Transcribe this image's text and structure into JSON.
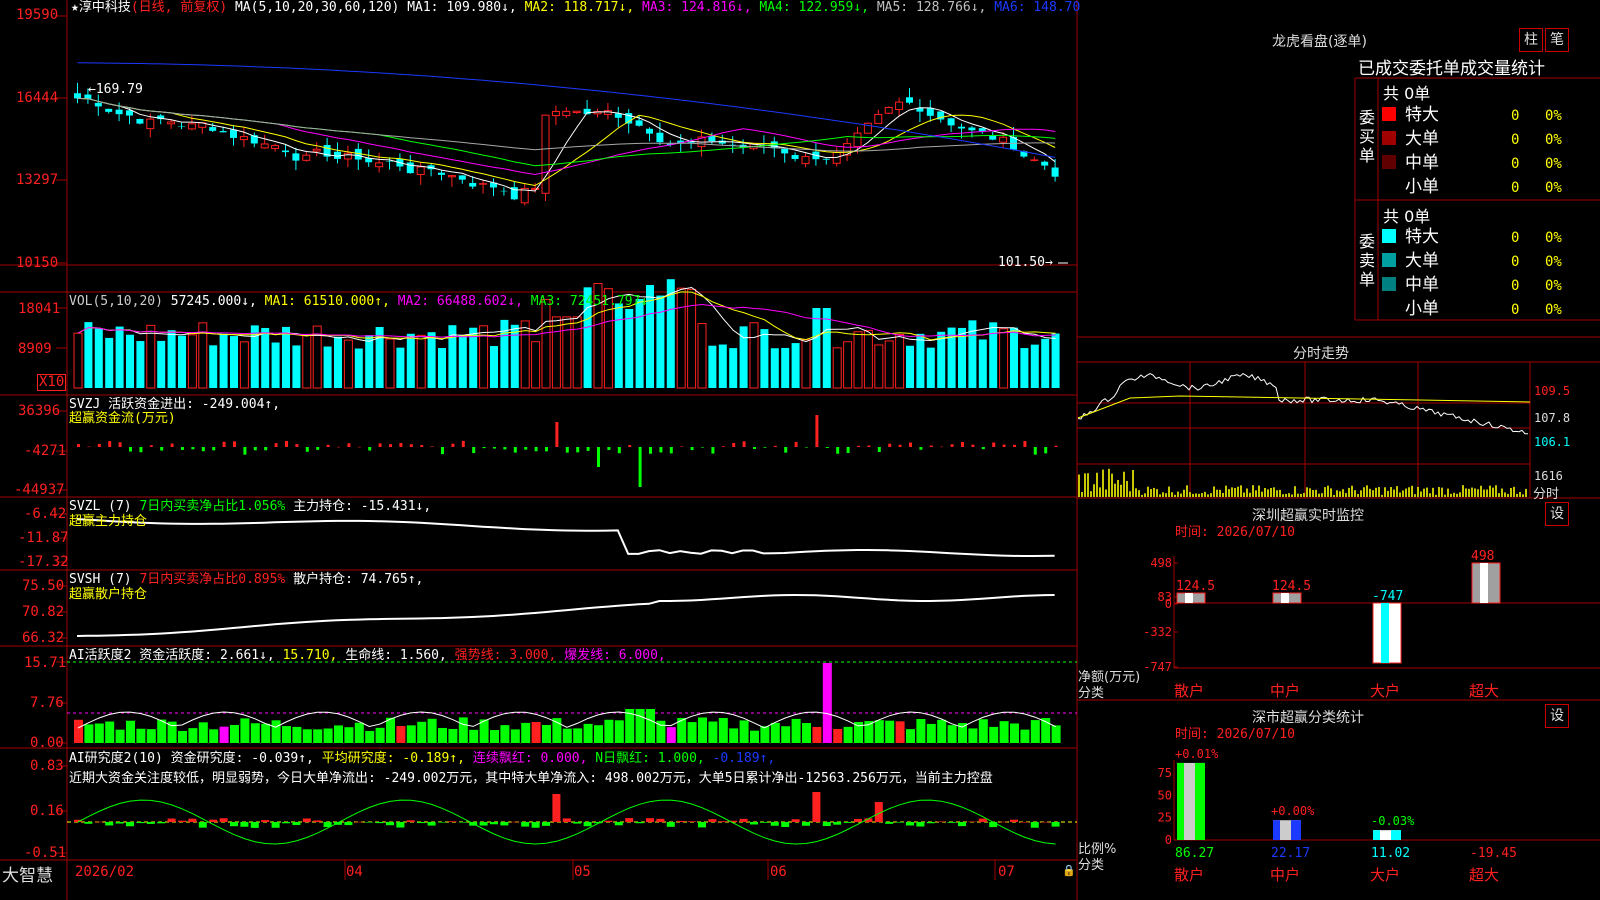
{
  "colors": {
    "up": "#ff2020",
    "down": "#00ffff",
    "grid": "#a00000",
    "yellow": "#ffff00",
    "white": "#ffffff",
    "magenta": "#ff00ff",
    "green": "#00ff00",
    "blue": "#1c39ff",
    "gray": "#a8a8a8",
    "olive": "#c8c800"
  },
  "brand": "大智慧",
  "price_panel": {
    "star": "★",
    "stock_name": "淳中科技",
    "period": "(日线, 前复权)",
    "ma_header": "MA(5,10,20,30,60,120)",
    "ma1": "MA1: 109.980↓,",
    "ma2": "MA2: 118.717↓,",
    "ma3": "MA3: 124.816↓,",
    "ma4": "MA4: 122.959↓,",
    "ma5": "MA5: 128.766↓,",
    "ma6": "MA6: 148.70",
    "high_label": "←169.79",
    "low_label": "101.50→",
    "axis": [
      "19590",
      "16444",
      "13297",
      "10150"
    ]
  },
  "vol_panel": {
    "header": "VOL(5,10,20)",
    "v": "57245.000↓,",
    "ma1": "MA1: 61510.000↑,",
    "ma2": "MA2: 66488.602↓,",
    "ma3": "MA3: 72451.797↓",
    "axis": [
      "18041",
      "8909"
    ],
    "unit": "X10"
  },
  "svzj_panel": {
    "header": "SVZJ  活跃资金进出: -249.004↑,",
    "subtitle": "超赢资金流(万元)",
    "axis": [
      "36396",
      "-4271",
      "-44937"
    ]
  },
  "svzl_panel": {
    "header": "SVZL (7)",
    "ratio": "7日内买卖净占比1.056%",
    "pos": "主力持仓: -15.431↓,",
    "subtitle": "超赢主力持仓",
    "axis": [
      "-6.42",
      "-11.87",
      "-17.32"
    ]
  },
  "svsh_panel": {
    "header": "SVSH (7)",
    "ratio": "7日内买卖净占比0.895%",
    "pos": "散户持仓: 74.765↑,",
    "subtitle": "超赢散户持仓",
    "axis": [
      "75.50",
      "70.82",
      "66.32"
    ]
  },
  "ai_active_panel": {
    "header": "AI活跃度2 资金活跃度: 2.661↓,",
    "v2": "15.710,",
    "life": "生命线: 1.560,",
    "strong": "强势线: 3.000,",
    "burst": "爆发线: 6.000,",
    "axis": [
      "15.71",
      "7.76",
      "0.00"
    ]
  },
  "ai_research_panel": {
    "header": "AI研究度2(10) 资金研究度: -0.039↑,",
    "avg": "平均研究度: -0.189↑,",
    "cont": "连续飘红: 0.000,",
    "nday": "N日飘红: 1.000,",
    "last": "-0.189↑,",
    "comment": "近期大资金关注度较低，明显弱势，今日大单净流出: -249.002万元，其中特大单净流入: 498.002万元，大单5日累计净出-12563.256万元，当前主力控盘",
    "axis": [
      "0.83",
      "0.16",
      "-0.51"
    ]
  },
  "date_axis": [
    "2026/02",
    "04",
    "05",
    "06",
    "07"
  ],
  "right": {
    "lhb_title": "龙虎看盘(逐单)",
    "btn_zhu": "柱",
    "btn_bi": "笔",
    "table_title": "已成交委托单成交量统计",
    "buy": {
      "side": [
        "委",
        "买",
        "单"
      ],
      "total": "共 0单",
      "rows": [
        {
          "label": "特大",
          "v": "0",
          "p": "0%",
          "color": "#ff0000"
        },
        {
          "label": "大单",
          "v": "0",
          "p": "0%",
          "color": "#a00000"
        },
        {
          "label": "中单",
          "v": "0",
          "p": "0%",
          "color": "#600000"
        },
        {
          "label": "小单",
          "v": "0",
          "p": "0%",
          "color": "#000000"
        }
      ]
    },
    "sell": {
      "side": [
        "委",
        "卖",
        "单"
      ],
      "total": "共 0单",
      "rows": [
        {
          "label": "特大",
          "v": "0",
          "p": "0%",
          "color": "#00ffff"
        },
        {
          "label": "大单",
          "v": "0",
          "p": "0%",
          "color": "#00a0a0"
        },
        {
          "label": "中单",
          "v": "0",
          "p": "0%",
          "color": "#008080"
        },
        {
          "label": "小单",
          "v": "0",
          "p": "0%",
          "color": "#000000"
        }
      ]
    },
    "intraday_title": "分时走势",
    "intraday_axis": [
      "109.5",
      "107.8",
      "106.1"
    ],
    "intraday_vol": [
      "1616",
      "分时"
    ],
    "sz_monitor": {
      "title": "深圳超赢实时监控",
      "btn": "设",
      "time": "时间: 2026/07/10",
      "ylabels": [
        "498",
        "83",
        "0",
        "-332",
        "-747"
      ],
      "unit1": "净额(万元)",
      "unit2": "分类",
      "categories": [
        "散户",
        "中户",
        "大户",
        "超大"
      ],
      "values": [
        124.5,
        124.5,
        -747,
        498
      ],
      "value_labels": [
        "124.5",
        "124.5",
        "-747",
        "498"
      ]
    },
    "sz_class": {
      "title": "深市超赢分类统计",
      "btn": "设",
      "time": "时间: 2026/07/10",
      "ylabels": [
        "75",
        "50",
        "25",
        "0"
      ],
      "unit1": "比例%",
      "unit2": "分类",
      "categories": [
        "散户",
        "中户",
        "大户",
        "超大"
      ],
      "values": [
        86.27,
        22.17,
        11.02,
        -19.45
      ],
      "value_labels": [
        "86.27",
        "22.17",
        "11.02",
        "-19.45"
      ],
      "top_labels": [
        "+0.01%",
        "+0.00%",
        "-0.03%",
        ""
      ]
    }
  }
}
